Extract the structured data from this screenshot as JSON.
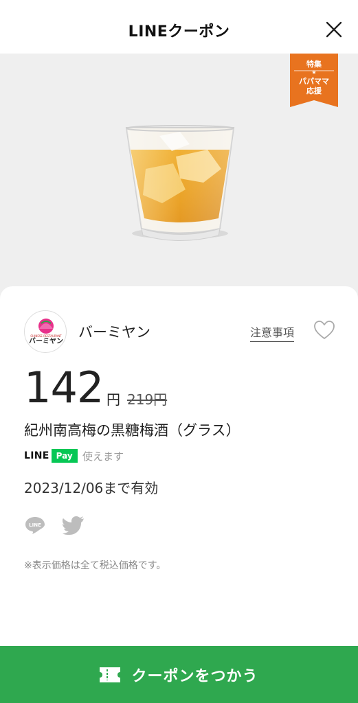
{
  "header": {
    "title": "LINEクーポン"
  },
  "badge": {
    "line1": "特集",
    "star": "★",
    "line2": "パパママ",
    "line3": "応援"
  },
  "store": {
    "name": "バーミヤン",
    "logo_text": "バーミヤン",
    "logo_subtext": "CHINESE RESTAURANT"
  },
  "notes_link": "注意事項",
  "price": {
    "value": "142",
    "yen": "円",
    "original": "219円"
  },
  "product_name": "紀州南高梅の黒糖梅酒（グラス）",
  "payment": {
    "line_label": "LINE",
    "pay_label": "Pay",
    "text": "使えます"
  },
  "validity": "2023/12/06まで有効",
  "share": {
    "line_icon_label": "LINE"
  },
  "tax_note": "※表示価格は全て税込価格です。",
  "cta": {
    "label": "クーポンをつかう"
  },
  "colors": {
    "accent_green": "#2fa84f",
    "badge_orange": "#e8731f",
    "linepay_green": "#06c755"
  }
}
